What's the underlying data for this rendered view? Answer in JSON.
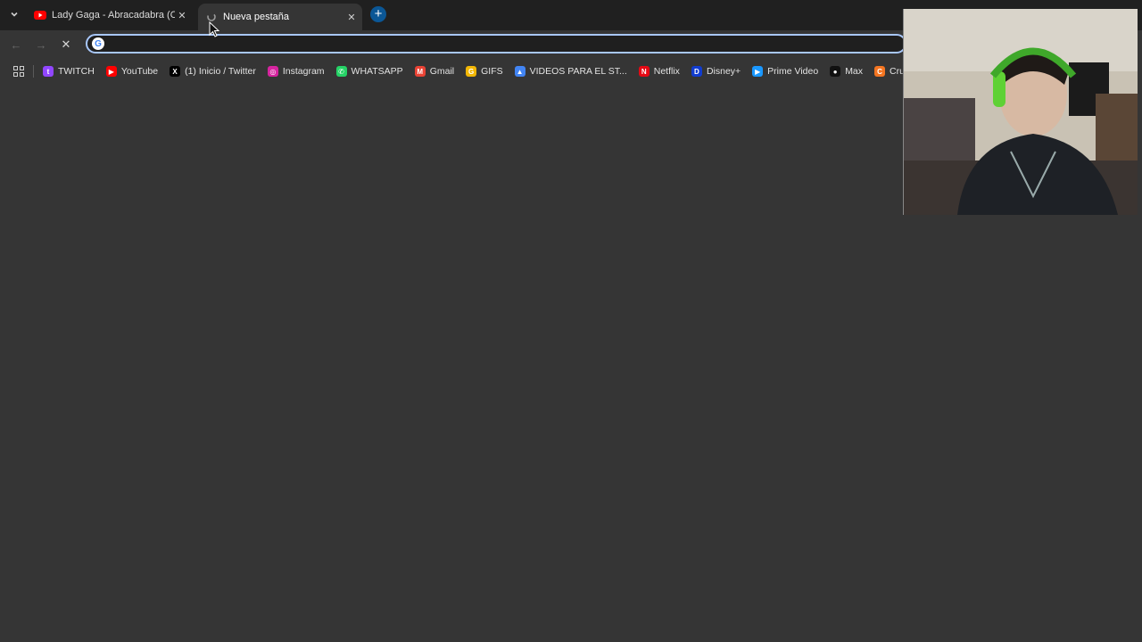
{
  "tabs": [
    {
      "title": "Lady Gaga - Abracadabra (Offic",
      "favicon": "youtube-icon",
      "active": false
    },
    {
      "title": "Nueva pestaña",
      "favicon": "loading-icon",
      "active": true
    }
  ],
  "omnibox": {
    "value": "",
    "placeholder": ""
  },
  "bookmarks": [
    {
      "label": "TWITCH",
      "icon": "twitch-icon",
      "color": "#9146ff",
      "glyph": "t"
    },
    {
      "label": "YouTube",
      "icon": "youtube-icon",
      "color": "#ff0000",
      "glyph": "▶"
    },
    {
      "label": "(1) Inicio / Twitter",
      "icon": "x-icon",
      "color": "#000000",
      "glyph": "X"
    },
    {
      "label": "Instagram",
      "icon": "instagram-icon",
      "color": "#d6249f",
      "glyph": "◎"
    },
    {
      "label": "WHATSAPP",
      "icon": "whatsapp-icon",
      "color": "#25d366",
      "glyph": "✆"
    },
    {
      "label": "Gmail",
      "icon": "gmail-icon",
      "color": "#ea4335",
      "glyph": "M"
    },
    {
      "label": "GIFS",
      "icon": "gifs-icon",
      "color": "#f2b705",
      "glyph": "G"
    },
    {
      "label": "VIDEOS PARA EL ST...",
      "icon": "drive-icon",
      "color": "#4285f4",
      "glyph": "▲"
    },
    {
      "label": "Netflix",
      "icon": "netflix-icon",
      "color": "#e50914",
      "glyph": "N"
    },
    {
      "label": "Disney+",
      "icon": "disney-icon",
      "color": "#113ccf",
      "glyph": "D"
    },
    {
      "label": "Prime Video",
      "icon": "prime-video-icon",
      "color": "#1a98ff",
      "glyph": "▶"
    },
    {
      "label": "Max",
      "icon": "max-icon",
      "color": "#111111",
      "glyph": "●"
    },
    {
      "label": "Crunchyroll",
      "icon": "crunchyroll-icon",
      "color": "#f47521",
      "glyph": "C"
    }
  ]
}
